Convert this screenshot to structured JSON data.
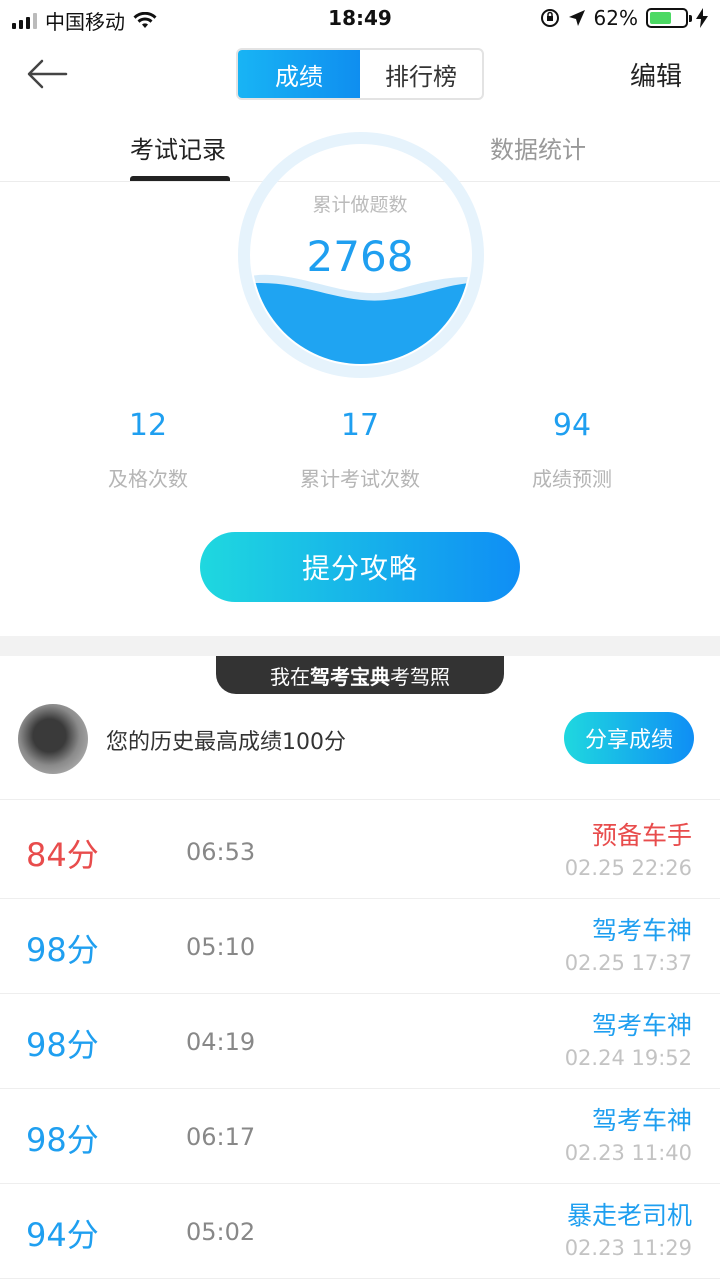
{
  "status_bar": {
    "carrier": "中国移动",
    "time": "18:49",
    "battery_percent": "62%",
    "battery_level": 0.62,
    "icons": [
      "signal-icon",
      "wifi-icon",
      "orientation-lock-icon",
      "location-icon",
      "battery-icon",
      "charging-icon"
    ]
  },
  "nav": {
    "segments": [
      "成绩",
      "排行榜"
    ],
    "active_segment": 0,
    "edit_label": "编辑",
    "back_icon": "back-arrow-icon"
  },
  "tabs": {
    "exam_records": "考试记录",
    "data_stats": "数据统计",
    "active": 0
  },
  "summary": {
    "total_questions_label": "累计做题数",
    "total_questions_value": "2768",
    "stats": [
      {
        "value": "12",
        "label": "及格次数"
      },
      {
        "value": "17",
        "label": "累计考试次数"
      },
      {
        "value": "94",
        "label": "成绩预测"
      }
    ],
    "cta_label": "提分攻略"
  },
  "banner": {
    "prefix": "我在",
    "brand": "驾考宝典",
    "suffix": "考驾照"
  },
  "profile": {
    "best_score_text": "您的历史最高成绩100分",
    "share_label": "分享成绩"
  },
  "colors": {
    "accent": "#1f9ff0",
    "fail": "#e84c4c",
    "gradient_start": "#1fd8df",
    "gradient_end": "#0f8ef5"
  },
  "records": [
    {
      "score": "84分",
      "duration": "06:53",
      "title": "预备车手",
      "time": "02.25 22:26",
      "passed": false
    },
    {
      "score": "98分",
      "duration": "05:10",
      "title": "驾考车神",
      "time": "02.25 17:37",
      "passed": true
    },
    {
      "score": "98分",
      "duration": "04:19",
      "title": "驾考车神",
      "time": "02.24 19:52",
      "passed": true
    },
    {
      "score": "98分",
      "duration": "06:17",
      "title": "驾考车神",
      "time": "02.23 11:40",
      "passed": true
    },
    {
      "score": "94分",
      "duration": "05:02",
      "title": "暴走老司机",
      "time": "02.23 11:29",
      "passed": true
    }
  ]
}
